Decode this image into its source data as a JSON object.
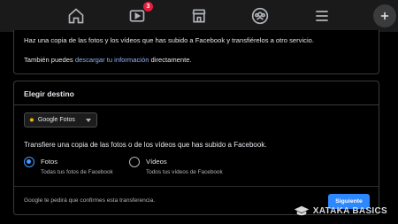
{
  "nav": {
    "notification_count": "3",
    "icons": [
      "home-icon",
      "watch-icon",
      "marketplace-icon",
      "groups-icon",
      "menu-icon"
    ]
  },
  "info_card": {
    "line1": "Haz una copia de las fotos y los vídeos que has subido a Facebook y transfiérelos a otro servicio.",
    "line2_prefix": "También puedes ",
    "line2_link": "descargar tu información",
    "line2_suffix": " directamente."
  },
  "destination": {
    "title": "Elegir destino",
    "selected_service": "Google Fotos",
    "transfer_text": "Transfiere una copia de las fotos o de los vídeos que has subido a Facebook.",
    "options": [
      {
        "label": "Fotos",
        "sublabel": "Todas tus fotos de Facebook",
        "checked": true
      },
      {
        "label": "Vídeos",
        "sublabel": "Todos tus vídeos de Facebook",
        "checked": false
      }
    ],
    "footer_note": "Google te pedirá que confirmes esta transferencia.",
    "next_label": "Siguiente"
  },
  "watermark": {
    "text": "XATAKA BASICS"
  },
  "colors": {
    "accent": "#2d88ff",
    "radio": "#4599ff",
    "link": "#8ab4f8",
    "badge": "#e41e3f"
  }
}
